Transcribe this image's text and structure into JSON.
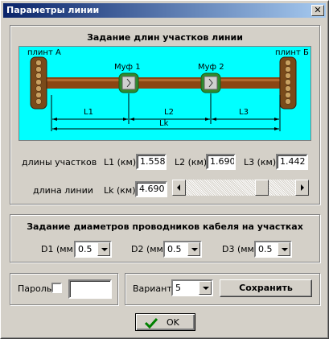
{
  "window": {
    "title": "Параметры линии",
    "close_glyph": "✕"
  },
  "lengths_group": {
    "title": "Задание длин участков линии",
    "diagram": {
      "left_terminal": "плинт А",
      "right_terminal": "плинт Б",
      "coupling1": "Муф 1",
      "coupling2": "Муф 2",
      "dim_l1": "L1",
      "dim_l2": "L2",
      "dim_l3": "L3",
      "dim_lk": "Lk",
      "colors": {
        "background": "#00ffff",
        "cable": "#8b4513",
        "terminal": "#7a4a1a",
        "coupling": "#2e8b2e"
      }
    },
    "segments_label": "длины участков",
    "l1_label": "L1 (км)",
    "l1_value": "1.558",
    "l2_label": "L2 (км)",
    "l2_value": "1.690",
    "l3_label": "L3 (км)",
    "l3_value": "1.442",
    "line_length_label": "длина линии",
    "lk_label": "Lk (км)",
    "lk_value": "4.690",
    "slider_position": 0.72
  },
  "diameters_group": {
    "title": "Задание диаметров проводников кабеля на участках",
    "d1_label": "D1 (мм)",
    "d1_value": "0.5",
    "d2_label": "D2 (мм)",
    "d2_value": "0.5",
    "d3_label": "D3 (мм)",
    "d3_value": "0.5"
  },
  "password": {
    "label": "Пароль",
    "checked": false,
    "value": ""
  },
  "variant": {
    "label": "Вариант",
    "value": "5",
    "save_label": "Сохранить"
  },
  "ok_button": {
    "label": "OK",
    "icon": "checkmark-icon"
  }
}
